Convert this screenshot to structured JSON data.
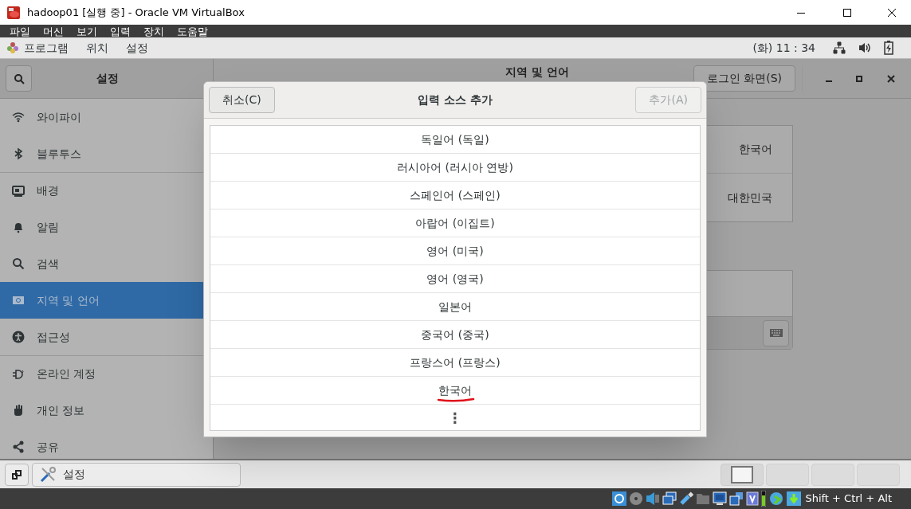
{
  "window": {
    "title": "hadoop01 [실행 중] - Oracle VM VirtualBox"
  },
  "menu_bar": [
    "파일",
    "머신",
    "보기",
    "입력",
    "장치",
    "도움말"
  ],
  "top_bar": {
    "menu": [
      "프로그램",
      "위치",
      "설정"
    ],
    "clock": "(화) 11 : 34"
  },
  "settings": {
    "sidebar_title": "설정",
    "page_title": "지역 및 언어",
    "login_screen_button": "로그인 화면(S)",
    "sidebar_groups": [
      [
        {
          "label": "와이파이",
          "selected": false
        },
        {
          "label": "블루투스",
          "selected": false
        }
      ],
      [
        {
          "label": "배경",
          "selected": false
        },
        {
          "label": "알림",
          "selected": false
        },
        {
          "label": "검색",
          "selected": false
        },
        {
          "label": "지역 및 언어",
          "selected": true
        },
        {
          "label": "접근성",
          "selected": false
        }
      ],
      [
        {
          "label": "온라인 계정",
          "selected": false
        },
        {
          "label": "개인 정보",
          "selected": false
        },
        {
          "label": "공유",
          "selected": false
        }
      ]
    ],
    "language_value": "한국어",
    "formats_value": "대한민국"
  },
  "dialog": {
    "title": "입력 소스 추가",
    "cancel_button": "취소(C)",
    "add_button": {
      "label": "추가(A)",
      "disabled": true
    },
    "items": [
      {
        "label": "독일어 (독일)",
        "underlined": false
      },
      {
        "label": "러시아어 (러시아 연방)",
        "underlined": false
      },
      {
        "label": "스페인어 (스페인)",
        "underlined": false
      },
      {
        "label": "아랍어 (이집트)",
        "underlined": false
      },
      {
        "label": "영어 (미국)",
        "underlined": false
      },
      {
        "label": "영어 (영국)",
        "underlined": false
      },
      {
        "label": "일본어",
        "underlined": false
      },
      {
        "label": "중국어 (중국)",
        "underlined": false
      },
      {
        "label": "프랑스어 (프랑스)",
        "underlined": false
      },
      {
        "label": "한국어",
        "underlined": true
      }
    ],
    "more": "⋮"
  },
  "taskbar": {
    "app": "설정",
    "workspaces": [
      {
        "selected": true
      },
      {
        "selected": false
      },
      {
        "selected": false
      },
      {
        "selected": false
      }
    ]
  },
  "status_bar": {
    "host_key": "Shift + Ctrl + Alt"
  }
}
